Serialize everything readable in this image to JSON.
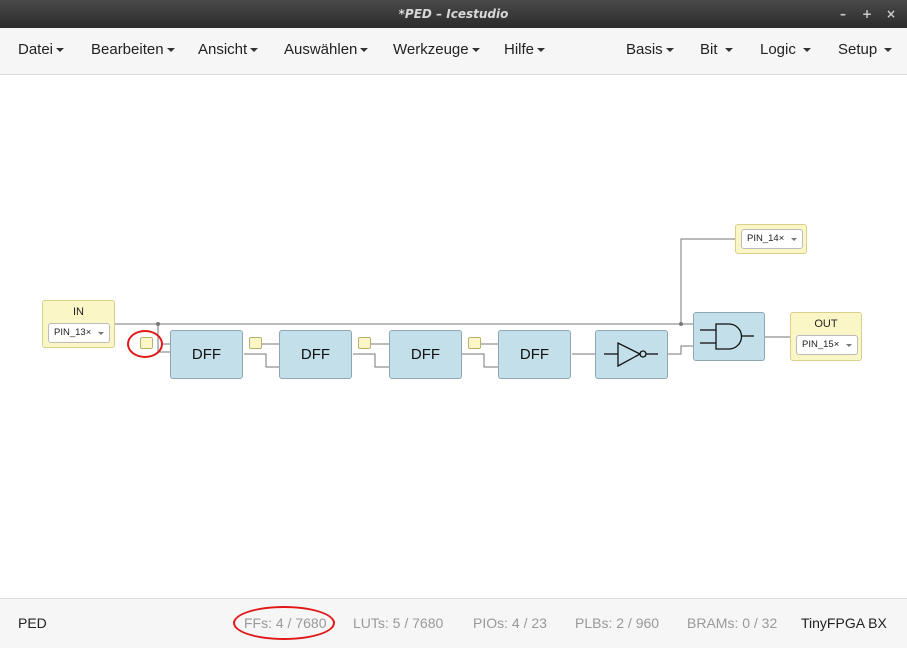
{
  "window": {
    "title": "*PED – Icestudio",
    "controls": [
      "–",
      "+",
      "×"
    ]
  },
  "menubar": {
    "left": [
      "Datei",
      "Bearbeiten",
      "Ansicht",
      "Auswählen",
      "Werkzeuge",
      "Hilfe"
    ],
    "right": [
      "Basis",
      "Bit",
      "Logic",
      "Setup"
    ]
  },
  "canvas": {
    "input_block": {
      "title": "IN",
      "pin": "PIN_13"
    },
    "output_block": {
      "title": "OUT",
      "pin": "PIN_15"
    },
    "extra_output": {
      "pin": "PIN_14"
    },
    "dff_label": "DFF",
    "dff_count": 4,
    "gates": [
      "not-gate",
      "and-gate"
    ]
  },
  "statusbar": {
    "project": "PED",
    "ffs": "FFs:  4 / 7680",
    "luts": "LUTs:  5 / 7680",
    "pios": "PIOs:  4 / 23",
    "plbs": "PLBs:  2 / 960",
    "brams": "BRAMs:  0 / 32",
    "board": "TinyFPGA BX"
  },
  "annotations": {
    "highlight_color": "#e01818"
  },
  "colors": {
    "block_blue": "#c3dfea",
    "io_yellow": "#fbf6c6",
    "wire": "#777777"
  }
}
